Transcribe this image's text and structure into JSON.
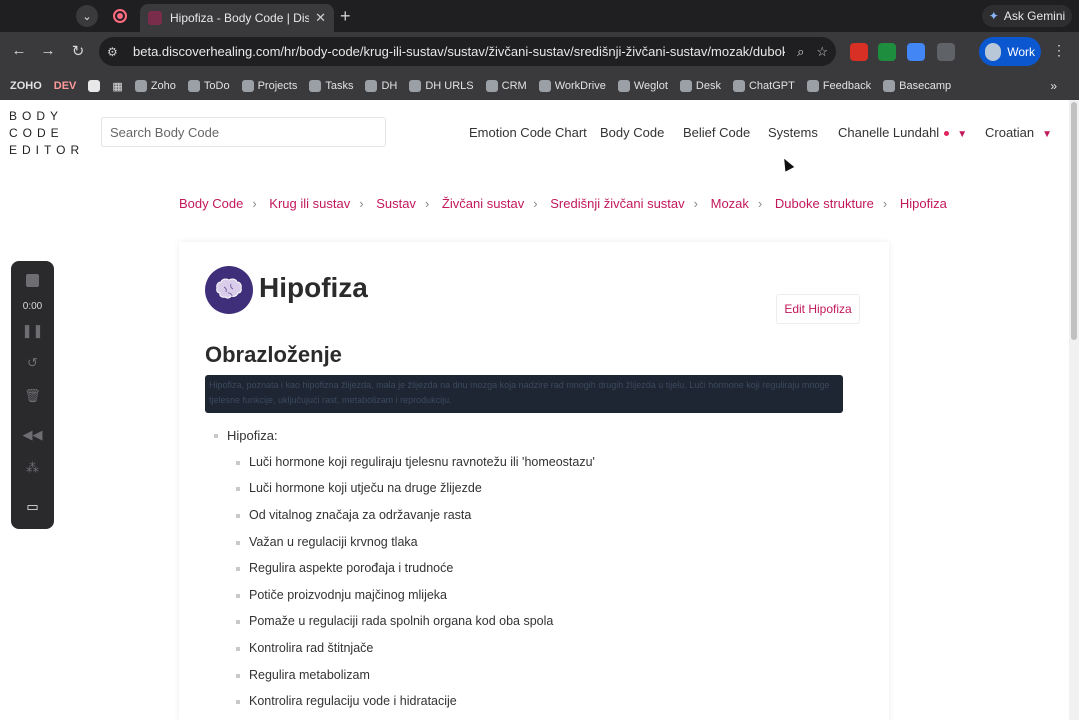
{
  "browser": {
    "tab_title": "Hipofiza - Body Code | Disco",
    "url": "beta.discoverhealing.com/hr/body-code/krug-ili-sustav/sustav/živčani-sustav/središnji-živčani-sustav/mozak/dubok...",
    "ask_gemini": "Ask Gemini",
    "profile_label": "Work",
    "bookmarks": [
      "ZOHO",
      "DEV",
      "Zoho",
      "ToDo",
      "Projects",
      "Tasks",
      "DH",
      "DH URLS",
      "CRM",
      "WorkDrive",
      "Weglot",
      "Desk",
      "ChatGPT",
      "Feedback",
      "Basecamp"
    ]
  },
  "site": {
    "logo_lines": [
      "BODY",
      "CODE",
      "EDITOR"
    ],
    "search_placeholder": "Search Body Code",
    "nav": [
      "Emotion Code Chart",
      "Body Code",
      "Belief Code",
      "Systems",
      "Chanelle Lundahl",
      "Croatian"
    ]
  },
  "breadcrumb": [
    "Body Code",
    "Krug ili sustav",
    "Sustav",
    "Živčani sustav",
    "Središnji živčani sustav",
    "Mozak",
    "Duboke strukture",
    "Hipofiza"
  ],
  "content": {
    "title": "Hipofiza",
    "edit_button": "Edit Hipofiza",
    "section_heading": "Obrazloženje",
    "highlight_text": "Hipofiza, poznata i kao hipofizna žlijezda, mala je žlijezda na dnu mozga koja nadzire rad mnogih drugih žlijezda u tijelu. Luči hormone koji reguliraju mnoge tjelesne funkcije, uključujući rast, metabolizam i reprodukciju.",
    "list_label": "Hipofiza:",
    "list_items": [
      "Luči hormone koji reguliraju tjelesnu ravnotežu ili 'homeostazu'",
      "Luči hormone koji utječu na druge žlijezde",
      "Od vitalnog značaja za održavanje rasta",
      "Važan u regulaciji krvnog tlaka",
      "Regulira aspekte porođaja i trudnoće",
      "Potiče proizvodnju majčinog mlijeka",
      "Pomaže u regulaciji rada spolnih organa kod oba spola",
      "Kontrolira rad štitnjače",
      "Regulira metabolizam",
      "Kontrolira regulaciju vode i hidratacije"
    ]
  },
  "recorder": {
    "time": "0:00"
  },
  "colors": {
    "accent": "#c2185b",
    "chrome": "#3a3a3d",
    "highlight": "#1e2533"
  }
}
